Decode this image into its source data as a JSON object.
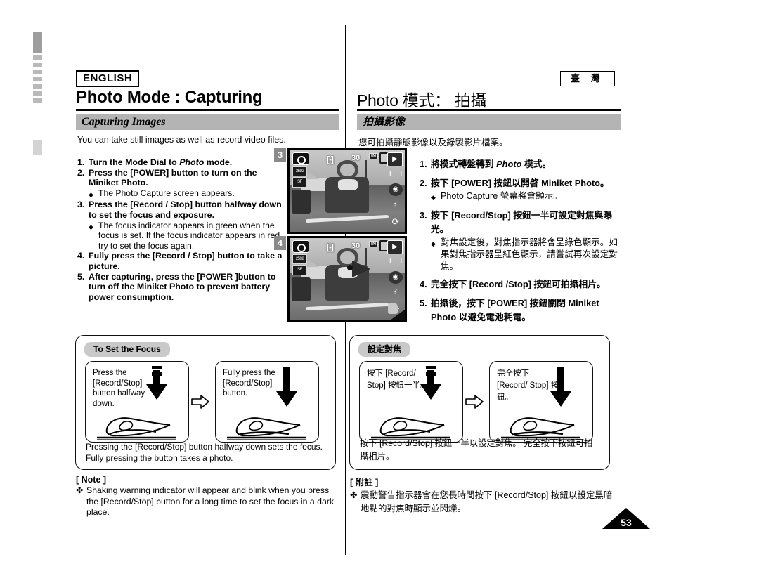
{
  "page": {
    "number": "53",
    "left_language_badge": "ENGLISH",
    "right_language_badge": "臺 灣"
  },
  "english": {
    "title": "Photo Mode : Capturing",
    "section_band": "Capturing Images",
    "intro": "You can take still images as well as record video files.",
    "steps": [
      {
        "num": "1.",
        "text": "Turn the Mode Dial to ",
        "em": "Photo",
        "text_after": " mode.",
        "subs": []
      },
      {
        "num": "2.",
        "text": "Press the [POWER] button to turn on the Miniket Photo.",
        "subs": [
          "The Photo Capture screen appears."
        ]
      },
      {
        "num": "3.",
        "text": "Press the [Record / Stop] button halfway down to set the focus and exposure.",
        "subs": [
          "The focus indicator appears in green when the focus is set. If the focus indicator appears in red, try to set the focus again."
        ]
      },
      {
        "num": "4.",
        "text": "Fully press the [Record / Stop] button to take a picture.",
        "subs": []
      },
      {
        "num": "5.",
        "text": "After capturing, press the [POWER ]button to turn off the Miniket Photo to prevent battery power consumption.",
        "subs": []
      }
    ],
    "focus_panel": {
      "tab": "To Set the Focus",
      "left_caption": "Press the [Record/Stop] button halfway down.",
      "right_caption": "Fully press the [Record/Stop] button.",
      "footer": "Pressing the [Record/Stop] button halfway down sets the focus. Fully pressing the button takes a photo."
    },
    "note": {
      "title": "[ Note ]",
      "mark": "✤",
      "body": "Shaking warning indicator will appear and blink when you press the [Record/Stop] button for a long time to set the focus in a dark place."
    }
  },
  "chinese": {
    "title": "Photo 模式： 拍攝",
    "section_band": "拍攝影像",
    "intro": "您可拍攝靜態影像以及錄製影片檔案。",
    "steps": [
      {
        "num": "1.",
        "text": "將模式轉盤轉到 ",
        "em": "Photo",
        "text_after": " 模式。",
        "subs": []
      },
      {
        "num": "2.",
        "text": "按下 [POWER] 按鈕以開啓 Miniket Photo。",
        "subs": [
          "Photo Capture 螢幕將會顯示。"
        ]
      },
      {
        "num": "3.",
        "text": "按下 [Record/Stop] 按鈕一半可設定對焦與曝光。",
        "subs": [
          "對焦設定後，對焦指示器將會呈綠色顯示。如果對焦指示器呈紅色顯示，請嘗試再次設定對焦。"
        ]
      },
      {
        "num": "4.",
        "text": "完全按下 [Record /Stop] 按鈕可拍攝相片。",
        "subs": []
      },
      {
        "num": "5.",
        "text": "拍攝後，按下 [POWER] 按鈕關閉 Miniket Photo 以避免電池耗電。",
        "subs": []
      }
    ],
    "focus_panel": {
      "tab": "設定對焦",
      "left_caption": "按下 [Record/ Stop] 按鈕一半。",
      "right_caption": "完全按下 [Record/ Stop] 按鈕。",
      "footer": "按下 [Record/Stop] 按鈕一半以設定對焦。 完全按下按鈕可拍攝相片。"
    },
    "note": {
      "title": "[ 附註 ]",
      "mark": "✤",
      "body": "震動警告指示器會在您長時間按下 [Record/Stop] 按鈕以設定黑暗地點的對焦時顯示並閃爍。"
    }
  },
  "screenshots": [
    {
      "step_label": "3",
      "osd": {
        "mode_icon": "camera-icon",
        "resolution": "2592",
        "quality": "SF",
        "focus_bracket": "[-]",
        "counter": "30",
        "memory": "IN",
        "battery": "battery-icon",
        "side_icons": [
          "playback-icon",
          "macro-icon",
          "redeye-icon",
          "flash-off-icon",
          "self-timer-icon"
        ]
      }
    },
    {
      "step_label": "4",
      "osd": {
        "mode_icon": "camera-icon",
        "resolution": "2592",
        "quality": "SF",
        "focus_bracket": "[-]",
        "counter": "30",
        "memory": "IN",
        "battery": "battery-icon",
        "side_icons": [
          "playback-icon",
          "macro-icon",
          "redeye-icon",
          "flash-off-icon",
          "self-timer-icon"
        ]
      }
    }
  ],
  "colors": {
    "band_gray": "#b4b4b4",
    "tab_gray": "#c9c9c9",
    "step_box_gray": "#8a8a8a",
    "rule_black": "#000000"
  }
}
